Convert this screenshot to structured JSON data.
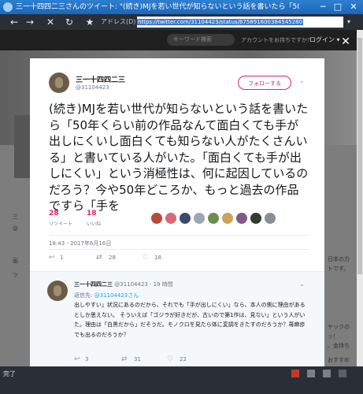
{
  "window": {
    "title": "三一十四四二三さんのツイート: \"(続き)MJを若い世代が知らないという話を書いたら「50年く\"",
    "minimize": "─",
    "maximize": "□",
    "close": "✕"
  },
  "toolbar": {
    "back": "←",
    "forward": "→",
    "stop": "✕",
    "refresh": "↻",
    "favorite": "★",
    "address_label": "アドレス(D)",
    "url": "https://twitter.com/31104423/status/875891600384545280",
    "dropdown": "▾"
  },
  "background_page": {
    "search_placeholder": "キーワード検索",
    "has_account": "アカウントをお持ちですか?",
    "login": "ログイン ▾",
    "side_left_1": "三",
    "side_left_2": "@",
    "side_left_3": "画",
    "side_left_4": "ツ",
    "side_right_1": "日本の力",
    "side_right_2": "トです。",
    "side_right_3": "ヤックの",
    "side_right_4": "ッ！",
    "side_right_5": "。金持ち",
    "side_right_6": "おすすめ"
  },
  "modal_close": "✕",
  "tweet": {
    "display_name": "三一十四四二三",
    "handle": "@31104423",
    "follow_label": "フォローする",
    "caret": "⌄",
    "text": "(続き)MJを若い世代が知らないという話を書いたら「50年くらい前の作品なんて面白くても手が出しにくいし面白くても知らない人がたくさんいる」と書いている人がいた。「面白くても手が出しにくい」という消極性は、何に起因しているのだろう？今や50年どころか、もっと過去の作品ですら「手を",
    "retweet_count": "28",
    "retweet_label": "リツイート",
    "like_count": "18",
    "like_label": "いいね",
    "timestamp": "18:43 - 2017年6月16日",
    "reply_count": "1",
    "rt_count": "28",
    "fav_count": "18"
  },
  "reply": {
    "display_name": "三一十四四二三",
    "handle": "@31104423",
    "separator": "·",
    "time": "19 時間",
    "caret": "⌄",
    "reply_to_label": "返信先:",
    "reply_to_handle": "@31104423さん",
    "text": "出しやすい」状況にあるのだから、それでも「手が出しにくい」なら、本人の側に理由があるとしか思えない。 そういえば「ゴジラが好きだが、古いので第1作は、見ない」という人がいた。理由は「白黒だから」だそうだ。モノクロを見たら体に変調をきたすのだろうか？蕁麻疹でも出るのだろうか？",
    "reply_count": "3",
    "rt_count": "31",
    "fav_count": "22"
  },
  "status": {
    "text": "完了"
  },
  "colors": {
    "accent": "#e0245e",
    "link": "#1da1f2",
    "titlebar": "#1b66b8",
    "chrome": "#2a2f36"
  }
}
